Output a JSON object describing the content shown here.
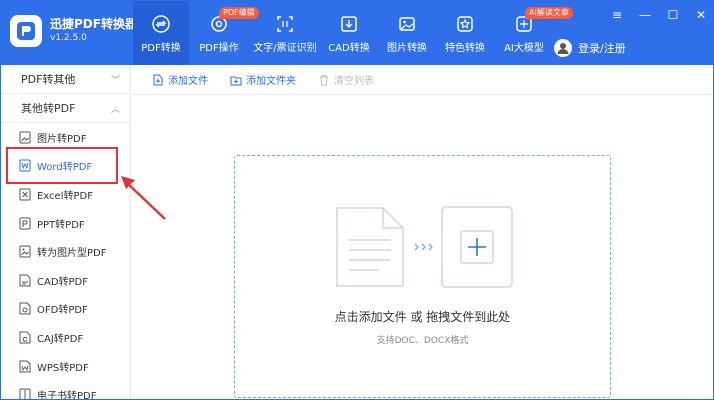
{
  "app": {
    "name": "迅捷PDF转换器",
    "version": "v1.2.5.0"
  },
  "nav": [
    {
      "label": "PDF转换",
      "icon": "exchange-icon",
      "badge": ""
    },
    {
      "label": "PDF操作",
      "icon": "gear-icon",
      "badge": "PDF编辑"
    },
    {
      "label": "文字/票证识别",
      "icon": "scan-text-icon",
      "badge": ""
    },
    {
      "label": "CAD转换",
      "icon": "cad-icon",
      "badge": ""
    },
    {
      "label": "图片转换",
      "icon": "image-icon",
      "badge": ""
    },
    {
      "label": "特色转换",
      "icon": "star-icon",
      "badge": ""
    },
    {
      "label": "AI大模型",
      "icon": "ai-icon",
      "badge": "AI解读文章"
    }
  ],
  "login": {
    "label": "登录/注册"
  },
  "window_controls": [
    "≡",
    "—",
    "☐",
    "✕"
  ],
  "sidebar": {
    "sections": [
      {
        "label": "PDF转其他",
        "chevron": "﹀"
      },
      {
        "label": "其他转PDF",
        "chevron": "︿"
      }
    ],
    "items": [
      {
        "label": "图片转PDF"
      },
      {
        "label": "Word转PDF"
      },
      {
        "label": "Excel转PDF"
      },
      {
        "label": "PPT转PDF"
      },
      {
        "label": "转为图片型PDF"
      },
      {
        "label": "CAD转PDF"
      },
      {
        "label": "OFD转PDF"
      },
      {
        "label": "CAJ转PDF"
      },
      {
        "label": "WPS转PDF"
      },
      {
        "label": "电子书转PDF"
      }
    ]
  },
  "toolbar": {
    "add_file": "添加文件",
    "add_folder": "添加文件夹",
    "clear_list": "清空列表"
  },
  "dropzone": {
    "main_text": "点击添加文件 或 拖拽文件到此处",
    "sub_text": "支持DOC、DOCX格式"
  },
  "colors": {
    "brand": "#2f6fe9",
    "highlight": "#e0333a"
  }
}
